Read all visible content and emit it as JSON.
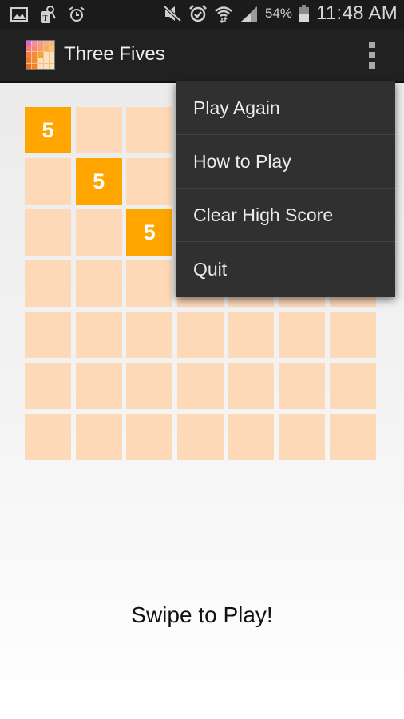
{
  "status_bar": {
    "left_icons": [
      "gallery-icon",
      "tag-notification-icon",
      "alarm-notification-icon"
    ],
    "right_icons": [
      "mute-icon",
      "alarm-icon",
      "wifi-icon",
      "signal-icon"
    ],
    "battery_percent": "54%",
    "battery_level": 0.54,
    "clock": "11:48 AM"
  },
  "action_bar": {
    "title": "Three Fives",
    "overflow_icon": "more-vertical-icon"
  },
  "board": {
    "columns": 7,
    "rows": 7,
    "colors": {
      "empty": "#fdd9b8",
      "filled": "#ffa500",
      "text": "#ffffff"
    },
    "cells": [
      [
        "5",
        "",
        "",
        "",
        "",
        "",
        ""
      ],
      [
        "",
        "5",
        "",
        "",
        "",
        "",
        ""
      ],
      [
        "",
        "",
        "5",
        "",
        "",
        "",
        ""
      ],
      [
        "",
        "",
        "",
        "",
        "",
        "",
        ""
      ],
      [
        "",
        "",
        "",
        "",
        "",
        "",
        ""
      ],
      [
        "",
        "",
        "",
        "",
        "",
        "",
        ""
      ],
      [
        "",
        "",
        "",
        "",
        "",
        "",
        ""
      ]
    ]
  },
  "overflow_menu": {
    "items": [
      {
        "label": "Play Again"
      },
      {
        "label": "How to Play"
      },
      {
        "label": "Clear High Score"
      },
      {
        "label": "Quit"
      }
    ]
  },
  "message": "Swipe to Play!"
}
